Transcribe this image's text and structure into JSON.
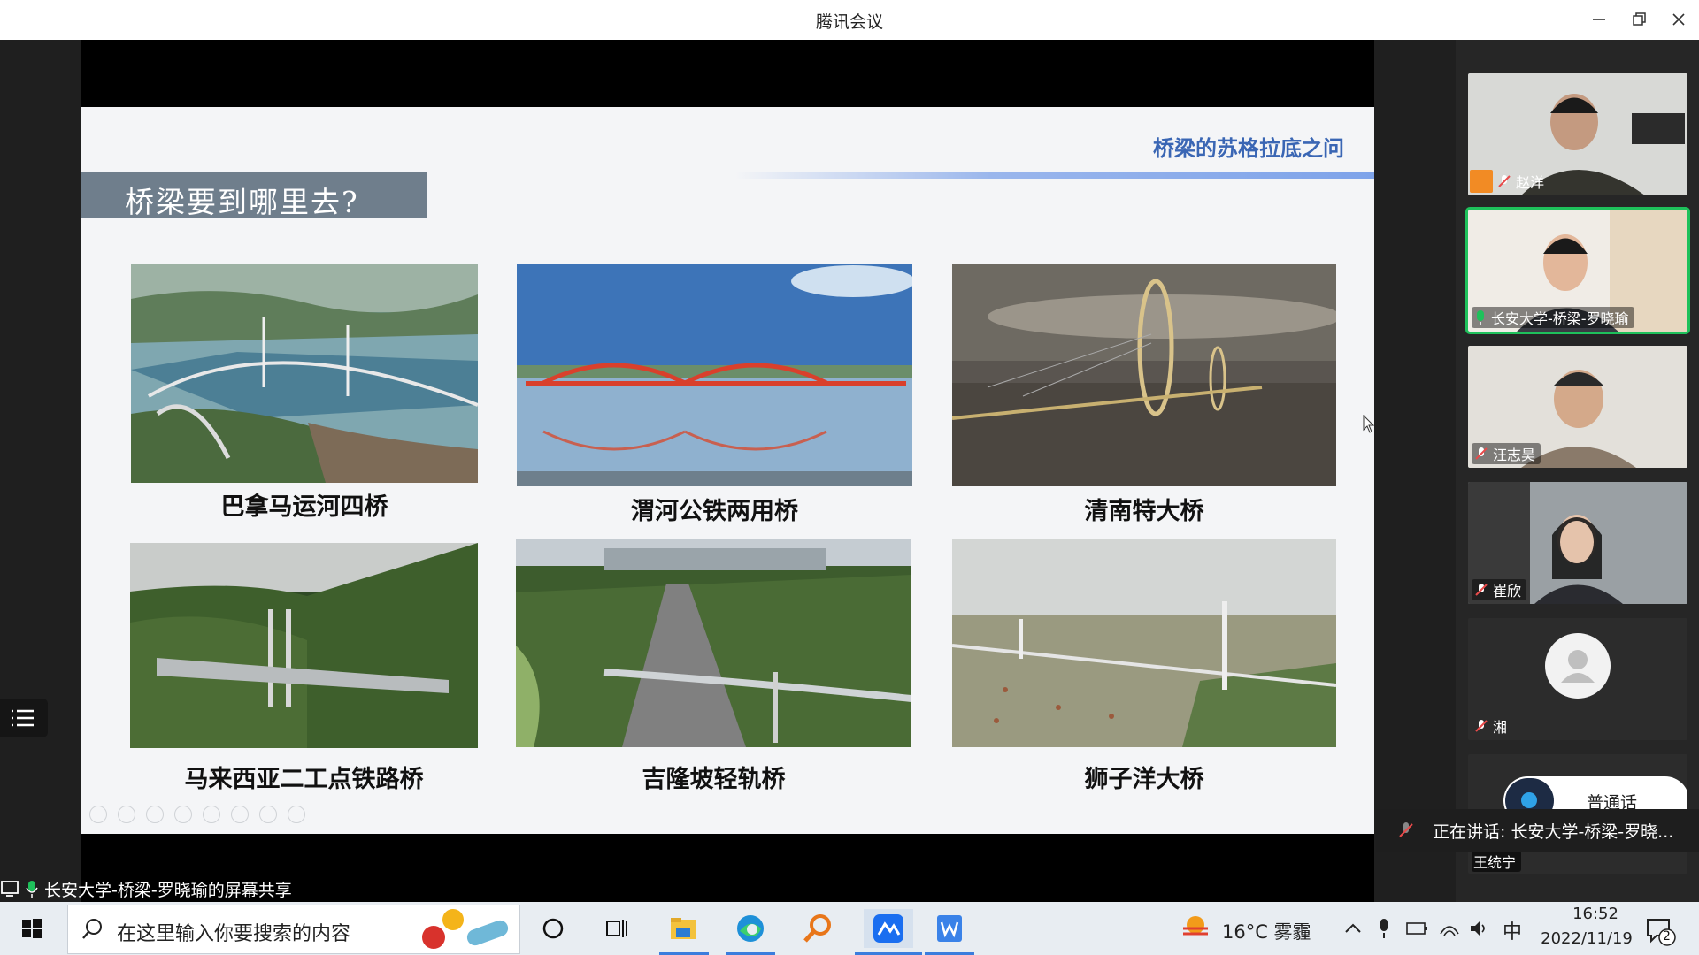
{
  "window": {
    "title": "腾讯会议",
    "minimize": "minimize",
    "maximize": "maximize",
    "close": "close"
  },
  "slide": {
    "header": "桥梁的苏格拉底之问",
    "section_title": "桥梁要到哪里去?",
    "bridges": [
      {
        "caption": "巴拿马运河四桥"
      },
      {
        "caption": "渭河公铁两用桥"
      },
      {
        "caption": "清南特大桥"
      },
      {
        "caption": "马来西亚二工点铁路桥"
      },
      {
        "caption": "吉隆坡轻轨桥"
      },
      {
        "caption": "狮子洋大桥"
      }
    ]
  },
  "share_label": "长安大学-桥梁-罗晓瑜的屏幕共享",
  "participants": [
    {
      "name": "赵洋"
    },
    {
      "name": "长安大学-桥梁-罗晓瑜"
    },
    {
      "name": "汪志昊"
    },
    {
      "name": "崔欣"
    },
    {
      "name": "湘"
    },
    {
      "name": "王统宁"
    }
  ],
  "subtitle_toggle": "普通话",
  "speaking": "正在讲话: 长安大学-桥梁-罗晓...",
  "taskbar": {
    "search_placeholder": "在这里输入你要搜索的内容",
    "weather": "16°C 雾霾",
    "ime": "中",
    "time": "16:52",
    "date": "2022/11/19",
    "notification_count": "2"
  },
  "colors": {
    "accent_green": "#1ec15b",
    "slide_blue": "#3a66b4",
    "section_box": "#6f7e8c"
  }
}
